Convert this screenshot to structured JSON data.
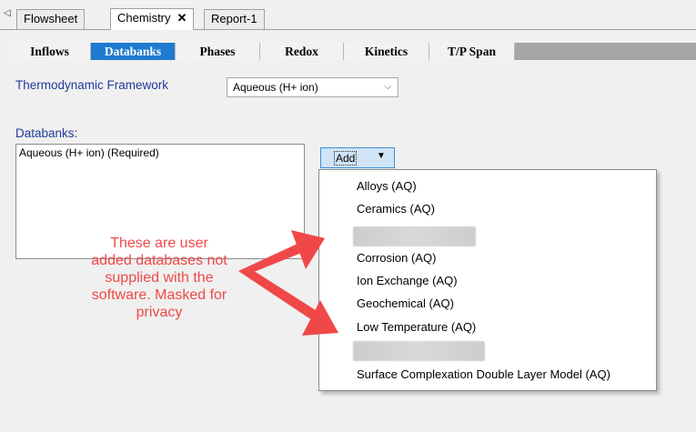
{
  "doc_tabs": {
    "scroll_glyph": "◁",
    "tabs": [
      {
        "label": "Flowsheet"
      },
      {
        "label": "Chemistry",
        "close": "✕"
      },
      {
        "label": "Report-1"
      }
    ]
  },
  "inner_tabs": [
    "Inflows",
    "Databanks",
    "Phases",
    "Redox",
    "Kinetics",
    "T/P Span"
  ],
  "active_inner_tab": "Databanks",
  "framework": {
    "label": "Thermodynamic Framework",
    "value": "Aqueous (H+ ion)"
  },
  "databanks": {
    "label": "Databanks:",
    "items": [
      "Aqueous (H+ ion) (Required)"
    ],
    "add_label": "Add"
  },
  "menu": {
    "items": [
      "Alloys (AQ)",
      "Ceramics (AQ)",
      "",
      "Corrosion (AQ)",
      "Ion Exchange (AQ)",
      "Geochemical (AQ)",
      "Low Temperature (AQ)",
      "",
      "Surface Complexation Double Layer Model (AQ)"
    ]
  },
  "annotation": {
    "lines": [
      "These are user",
      "added databases not",
      "supplied with the",
      "software. Masked for",
      "privacy"
    ],
    "color": "#f04848"
  },
  "colors": {
    "active_tab": "#1e7bd0",
    "label_blue": "#1f3b9a",
    "add_button_bg": "#cfe4f7"
  }
}
